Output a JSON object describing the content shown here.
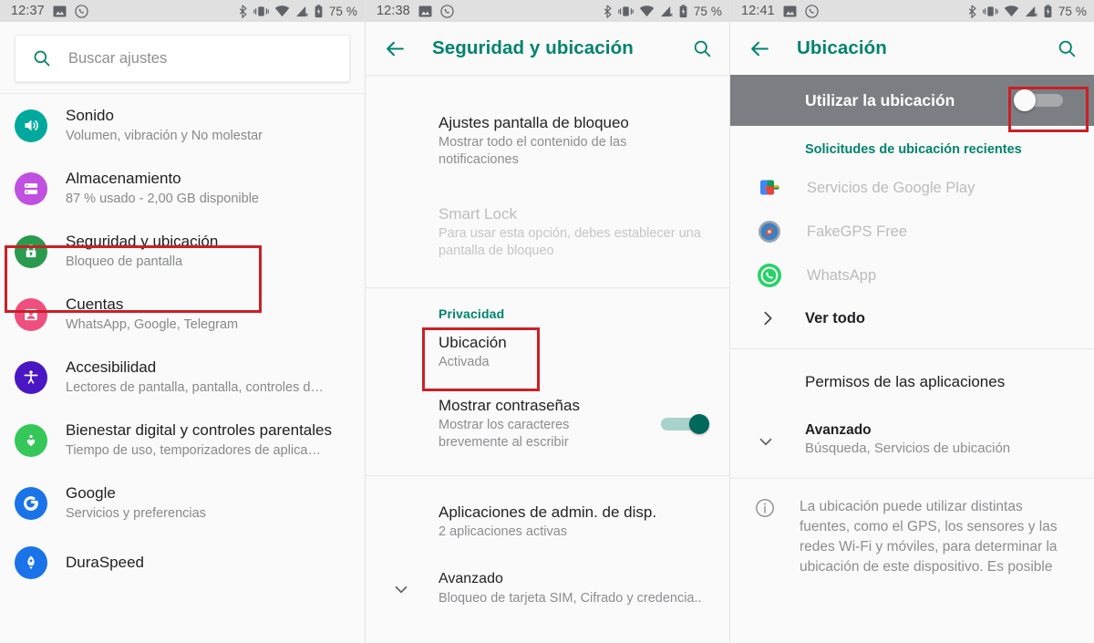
{
  "panels": [
    {
      "status": {
        "time": "12:37",
        "battery": "75 %",
        "icons": [
          "photo-icon",
          "whatsapp-icon",
          "bluetooth-icon",
          "vibrate-icon",
          "wifi-icon",
          "signal-off-icon",
          "battery-charging-icon"
        ]
      },
      "search": {
        "placeholder": "Buscar ajustes"
      },
      "items": [
        {
          "title": "Sonido",
          "subtitle": "Volumen, vibración y No molestar",
          "icon": "volume-icon",
          "color": "#00a99d"
        },
        {
          "title": "Almacenamiento",
          "subtitle": "87 % usado - 2,00 GB disponible",
          "icon": "storage-icon",
          "color": "#c050e0"
        },
        {
          "title": "Seguridad y ubicación",
          "subtitle": "Bloqueo de pantalla",
          "icon": "lock-icon",
          "color": "#2a9a4e",
          "highlighted": true
        },
        {
          "title": "Cuentas",
          "subtitle": "WhatsApp, Google, Telegram",
          "icon": "account-icon",
          "color": "#ee4f7e"
        },
        {
          "title": "Accesibilidad",
          "subtitle": "Lectores de pantalla, pantalla, controles d…",
          "icon": "accessibility-icon",
          "color": "#4a17c4"
        },
        {
          "title": "Bienestar digital y controles parentales",
          "subtitle": "Tiempo de uso, temporizadores de aplica…",
          "icon": "wellbeing-icon",
          "color": "#35c75a"
        },
        {
          "title": "Google",
          "subtitle": "Servicios y preferencias",
          "icon": "google-g-icon",
          "color": "#1a73e8"
        },
        {
          "title": "DuraSpeed",
          "subtitle": "",
          "icon": "rocket-icon",
          "color": "#1a73e8"
        }
      ]
    },
    {
      "status": {
        "time": "12:38",
        "battery": "75 %"
      },
      "appbar": {
        "title": "Seguridad y ubicación",
        "back": "back-arrow-icon",
        "search": "search-icon"
      },
      "rows": [
        {
          "title": "Ajustes pantalla de bloqueo",
          "desc": "Mostrar todo el contenido de las notificaciones",
          "dim": false
        },
        {
          "title": "Smart Lock",
          "desc": "Para usar esta opción, debes establecer una pantalla de bloqueo",
          "dim": true
        }
      ],
      "section": "Privacidad",
      "location_row": {
        "title": "Ubicación",
        "desc": "Activada",
        "highlighted": true
      },
      "passwords_row": {
        "title": "Mostrar contraseñas",
        "desc": "Mostrar los caracteres brevemente al escribir",
        "toggle": "on"
      },
      "admin_row": {
        "title": "Aplicaciones de admin. de disp.",
        "desc": "2 aplicaciones activas"
      },
      "advanced_row": {
        "title": "Avanzado",
        "desc": "Bloqueo de tarjeta SIM, Cifrado y credencia..",
        "chevron": "chevron-down-icon"
      }
    },
    {
      "status": {
        "time": "12:41",
        "battery": "75 %"
      },
      "appbar": {
        "title": "Ubicación",
        "back": "back-arrow-icon",
        "search": "search-icon"
      },
      "master": {
        "label": "Utilizar la ubicación",
        "state": "off",
        "highlighted": true
      },
      "recent_head": "Solicitudes de ubicación recientes",
      "apps": [
        {
          "name": "Servicios de Google Play",
          "icon": "play-services-icon"
        },
        {
          "name": "FakeGPS Free",
          "icon": "compass-icon"
        },
        {
          "name": "WhatsApp",
          "icon": "whatsapp-icon"
        }
      ],
      "see_all": {
        "label": "Ver todo",
        "icon": "chevron-right-icon"
      },
      "permissions": {
        "label": "Permisos de las aplicaciones"
      },
      "advanced": {
        "title": "Avanzado",
        "desc": "Búsqueda, Servicios de ubicación",
        "icon": "chevron-down-icon"
      },
      "info": {
        "icon": "info-icon",
        "text": "La ubicación puede utilizar distintas fuentes, como el GPS, los sensores y las redes Wi-Fi y móviles, para determinar la ubicación de este dispositivo. Es posible"
      }
    }
  ],
  "colors": {
    "accent": "#00836d",
    "highlight": "#cc1f26",
    "statusbar": "#e0e0e0",
    "master_bar": "#7b7f83"
  }
}
